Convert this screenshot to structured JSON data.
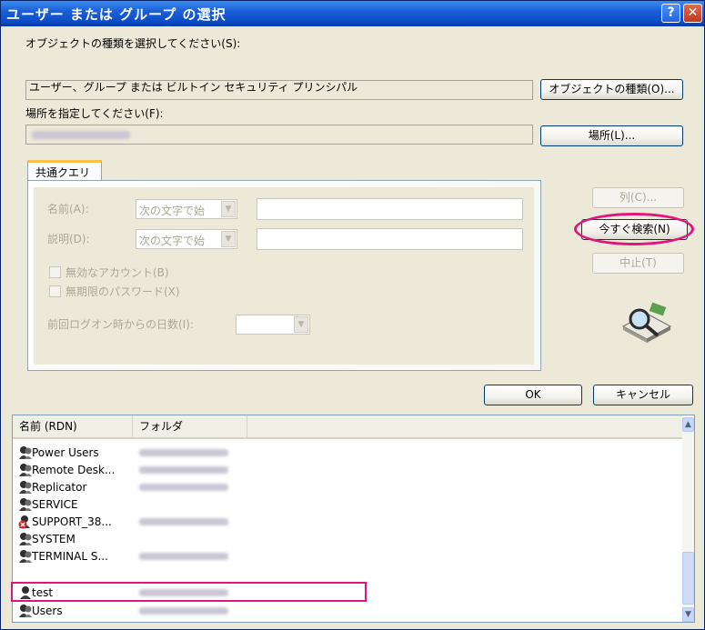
{
  "window": {
    "title": "ユーザー または グループ の選択",
    "help_label": "?",
    "close_label": "✕"
  },
  "object_types": {
    "label": "オブジェクトの種類を選択してください(S):",
    "value": "ユーザー、グループ または ビルトイン セキュリティ プリンシパル",
    "button": "オブジェクトの種類(O)..."
  },
  "location": {
    "label": "場所を指定してください(F):",
    "button": "場所(L)..."
  },
  "tabs": [
    {
      "label": "共通クエリ"
    }
  ],
  "query": {
    "name_label": "名前(A):",
    "name_mode": "次の文字で始",
    "desc_label": "説明(D):",
    "desc_mode": "次の文字で始",
    "disabled_accounts": "無効なアカウント(B)",
    "non_expiring_password": "無期限のパスワード(X)",
    "days_since_logon": "前回ログオン時からの日数(I):"
  },
  "side_buttons": {
    "columns": "列(C)...",
    "search_now": "今すぐ検索(N)",
    "stop": "中止(T)"
  },
  "footer": {
    "ok": "OK",
    "cancel": "キャンセル"
  },
  "results": {
    "columns": [
      "名前 (RDN)",
      "フォルダ"
    ],
    "rows": [
      {
        "name": "Power Users",
        "icon": "group-icon"
      },
      {
        "name": "Remote Desk...",
        "icon": "group-icon"
      },
      {
        "name": "Replicator",
        "icon": "group-icon"
      },
      {
        "name": "SERVICE",
        "icon": "group-icon"
      },
      {
        "name": "SUPPORT_38...",
        "icon": "disabled-user-icon"
      },
      {
        "name": "SYSTEM",
        "icon": "group-icon"
      },
      {
        "name": "TERMINAL S...",
        "icon": "group-icon"
      },
      {
        "name": "test",
        "icon": "user-icon"
      },
      {
        "name": "Users",
        "icon": "group-icon"
      }
    ]
  },
  "colors": {
    "title_bar": "#0a4bc4",
    "dialog_bg": "#ece9d8",
    "annotation": "#e0157f",
    "disabled_text": "#aca899"
  }
}
